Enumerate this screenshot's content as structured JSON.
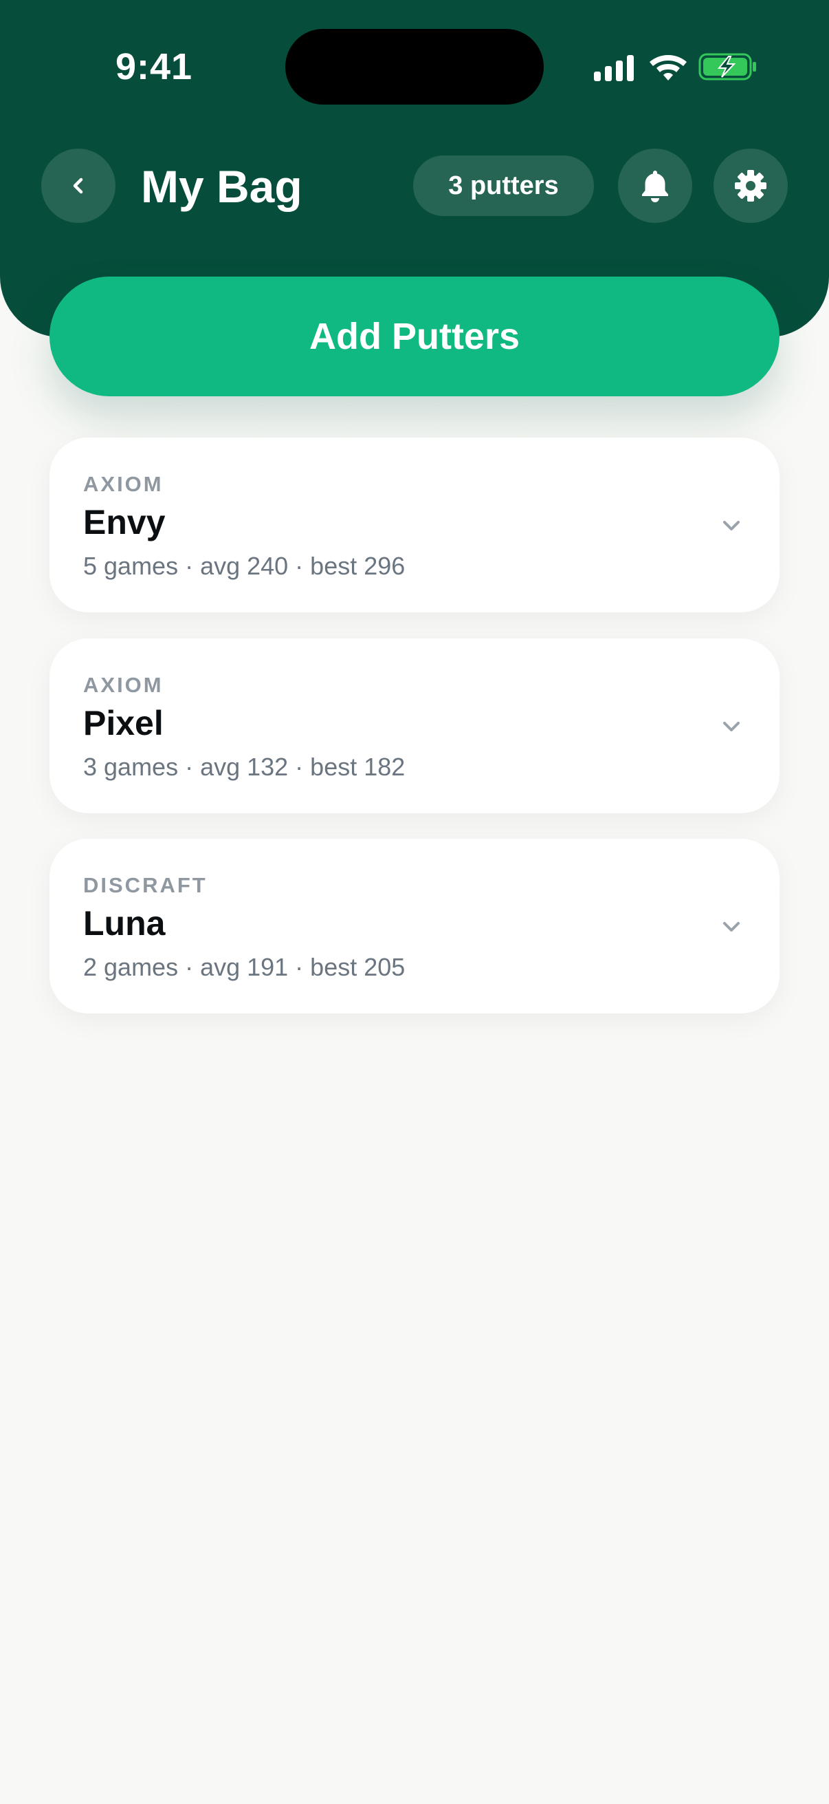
{
  "status": {
    "time": "9:41"
  },
  "header": {
    "title": "My Bag",
    "count_badge": "3 putters",
    "back_icon": "chevron-left-icon",
    "bell_icon": "bell-icon",
    "settings_icon": "gear-icon"
  },
  "actions": {
    "add_label": "Add Putters"
  },
  "putters": [
    {
      "brand": "AXIOM",
      "name": "Envy",
      "stats": "5 games · avg 240 · best 296"
    },
    {
      "brand": "AXIOM",
      "name": "Pixel",
      "stats": "3 games · avg 132 · best 182"
    },
    {
      "brand": "DISCRAFT",
      "name": "Luna",
      "stats": "2 games · avg 191 · best 205"
    }
  ],
  "colors": {
    "header_bg": "#064e3b",
    "accent": "#10b981",
    "page_bg": "#f8f9f6",
    "battery": "#34c759"
  }
}
